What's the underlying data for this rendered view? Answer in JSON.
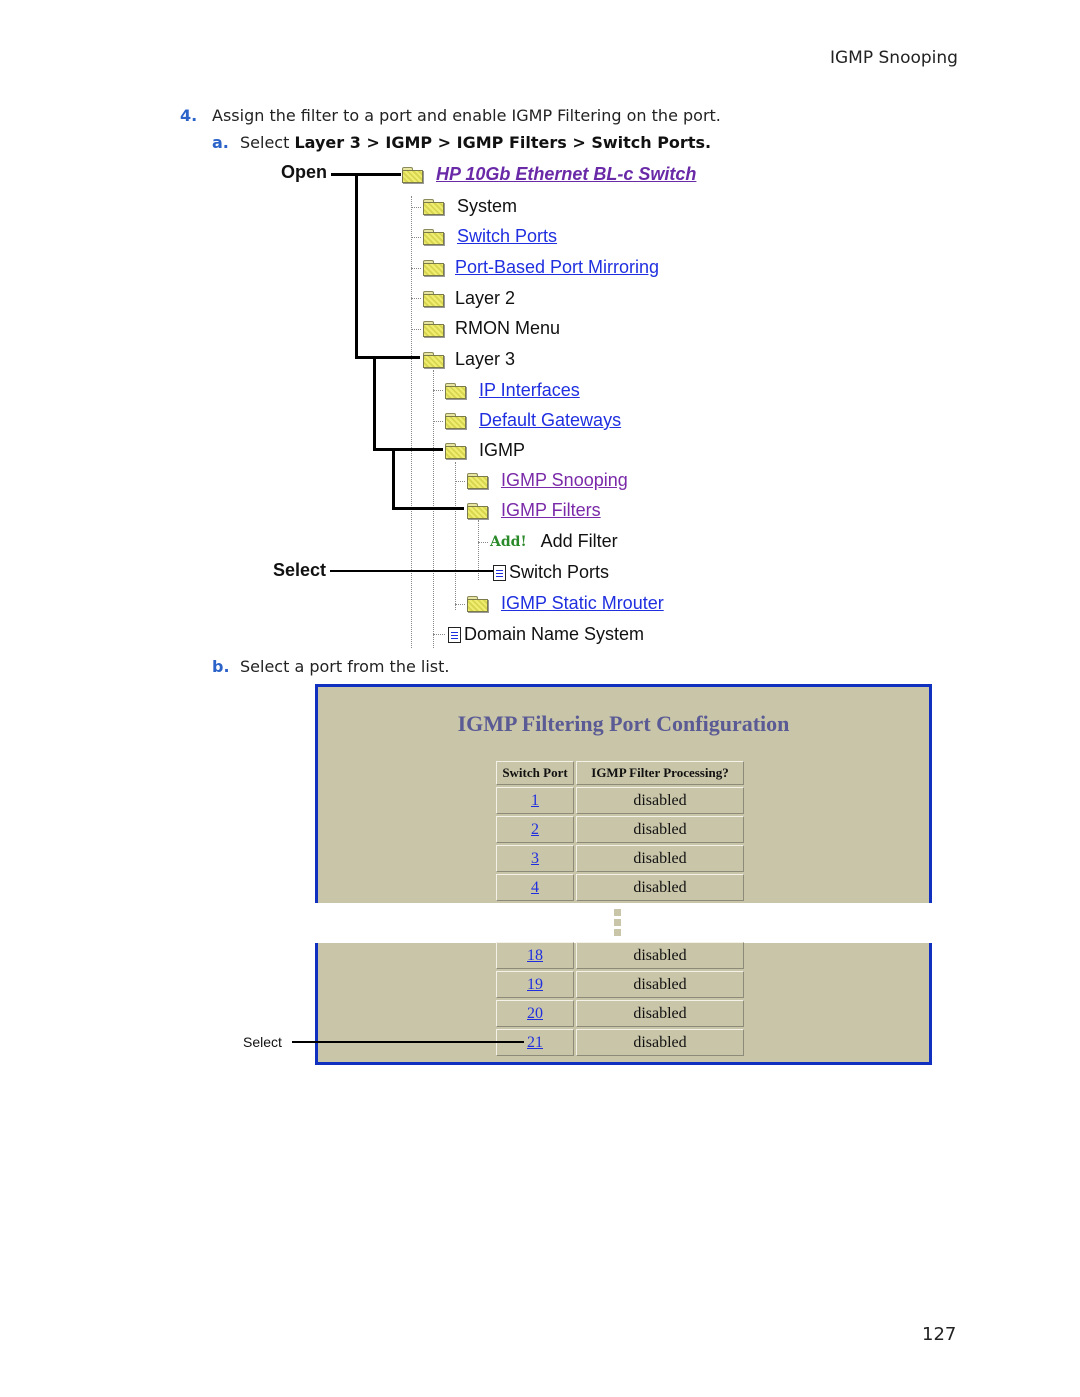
{
  "running_head": "IGMP Snooping",
  "page_number": "127",
  "steps": {
    "step4": {
      "num": "4.",
      "text": "Assign the filter to a port and enable IGMP Filtering on the port."
    },
    "a": {
      "num": "a.",
      "prefix": "Select ",
      "path": "Layer 3 > IGMP > IGMP Filters > Switch Ports."
    },
    "b": {
      "num": "b.",
      "text": "Select a port from the list."
    }
  },
  "callouts": {
    "open": "Open",
    "select_tree": "Select",
    "select_table": "Select"
  },
  "tree": {
    "root": {
      "label": "HP 10Gb Ethernet BL-c Switch",
      "icon": "folder-open-icon"
    },
    "items": [
      {
        "label": "System",
        "style": "plain",
        "icon": "folder-icon"
      },
      {
        "label": "Switch Ports",
        "style": "link",
        "icon": "folder-icon"
      },
      {
        "label": "Port-Based Port Mirroring",
        "style": "link",
        "icon": "folder-icon"
      },
      {
        "label": "Layer 2",
        "style": "plain",
        "icon": "folder-icon"
      },
      {
        "label": "RMON Menu",
        "style": "plain",
        "icon": "folder-icon"
      },
      {
        "label": "Layer 3",
        "style": "plain",
        "icon": "folder-open-icon"
      },
      {
        "label": "IP Interfaces",
        "style": "link",
        "icon": "folder-icon"
      },
      {
        "label": "Default Gateways",
        "style": "link",
        "icon": "folder-icon"
      },
      {
        "label": "IGMP",
        "style": "plain",
        "icon": "folder-open-icon"
      },
      {
        "label": "IGMP Snooping",
        "style": "visited",
        "icon": "folder-icon"
      },
      {
        "label": "IGMP Filters",
        "style": "visited",
        "icon": "folder-open-icon"
      },
      {
        "label": "Add Filter",
        "style": "plain",
        "icon": "add-icon",
        "icon_text": "Add!"
      },
      {
        "label": "Switch Ports",
        "style": "plain",
        "icon": "document-icon"
      },
      {
        "label": "IGMP Static Mrouter",
        "style": "link",
        "icon": "folder-icon"
      },
      {
        "label": "Domain Name System",
        "style": "plain",
        "icon": "document-icon"
      }
    ]
  },
  "panel": {
    "title": "IGMP Filtering Port Configuration",
    "columns": [
      "Switch Port",
      "IGMP Filter Processing?"
    ],
    "rows_top": [
      {
        "port": "1",
        "status": "disabled"
      },
      {
        "port": "2",
        "status": "disabled"
      },
      {
        "port": "3",
        "status": "disabled"
      },
      {
        "port": "4",
        "status": "disabled"
      }
    ],
    "rows_bottom": [
      {
        "port": "18",
        "status": "disabled"
      },
      {
        "port": "19",
        "status": "disabled"
      },
      {
        "port": "20",
        "status": "disabled"
      },
      {
        "port": "21",
        "status": "disabled"
      }
    ]
  },
  "colors": {
    "accent": "#2b63c9",
    "panel_bg": "#c9c5a8",
    "panel_border": "#1030c0",
    "link": "#1f2fe0",
    "visited": "#7a2aa8"
  }
}
